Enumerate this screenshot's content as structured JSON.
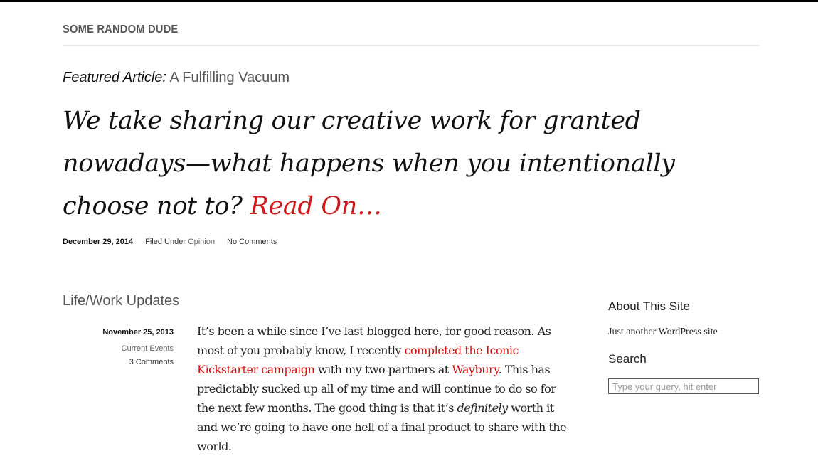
{
  "site": {
    "title": "SOME RANDOM DUDE"
  },
  "featured": {
    "label": "Featured Article:",
    "title": "A Fulfilling Vacuum",
    "headline": "We take sharing our creative work for granted nowadays—what happens when you intentionally choose not to?",
    "read_on": "Read On…",
    "date": "December 29, 2014",
    "filed_under_label": "Filed Under",
    "category": "Opinion",
    "comments": "No Comments"
  },
  "section": {
    "title": "Life/Work Updates"
  },
  "post": {
    "date": "November 25, 2013",
    "category": "Current Events",
    "comments": "3 Comments",
    "p1": "It’s been a while since I’ve last blogged here, for good reason. As most of you probably know, I recently ",
    "link1": "completed the Iconic Kickstarter campaign",
    "p2": " with my two partners at ",
    "link2": "Waybury",
    "p3": ". This has predictably sucked up all of my time and will continue to do so for the next few months. The good thing is that it’s ",
    "em": "definitely",
    "p4": " worth it and we’re going to have one hell of a final product to share with the world."
  },
  "sidebar": {
    "about_title": "About This Site",
    "about_text": "Just another WordPress site",
    "search_title": "Search",
    "search_placeholder": "Type your query, hit enter",
    "search_value": ""
  },
  "colors": {
    "accent": "#d11a1a",
    "text": "#222222",
    "muted": "#555555"
  }
}
